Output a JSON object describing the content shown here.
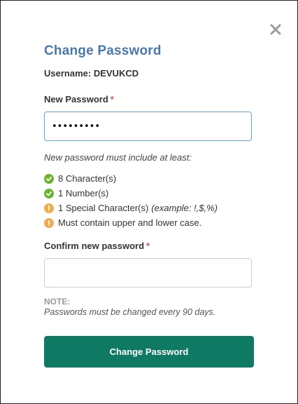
{
  "dialog": {
    "title": "Change Password",
    "username_label": "Username:",
    "username_value": "DEVUKCD",
    "close_icon": "close-icon"
  },
  "new_password": {
    "label": "New Password",
    "required_marker": "*",
    "value": "•••••••••"
  },
  "rules": {
    "intro": "New password must include at least:",
    "items": [
      {
        "text": "8 Character(s)",
        "example": "",
        "status": "met",
        "icon": "check-circle-icon"
      },
      {
        "text": "1 Number(s)",
        "example": "",
        "status": "met",
        "icon": "check-circle-icon"
      },
      {
        "text": "1 Special Character(s)",
        "example": "(example: !,$,%)",
        "status": "unmet",
        "icon": "exclamation-circle-icon"
      },
      {
        "text": "Must contain upper and lower case.",
        "example": "",
        "status": "unmet",
        "icon": "exclamation-circle-icon"
      }
    ]
  },
  "confirm_password": {
    "label": "Confirm new password",
    "required_marker": "*",
    "value": ""
  },
  "note": {
    "title": "NOTE:",
    "text": "Passwords must be changed every 90 days."
  },
  "submit": {
    "label": "Change Password"
  },
  "colors": {
    "title": "#4a79a8",
    "required": "#d9534f",
    "met": "#6cb32f",
    "unmet": "#f0ad4e",
    "button": "#0f7a63",
    "focus_border": "#66a6d6"
  }
}
